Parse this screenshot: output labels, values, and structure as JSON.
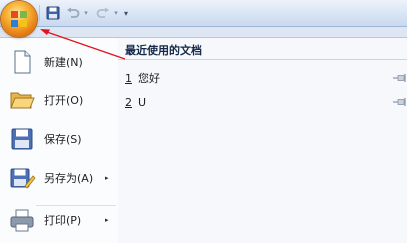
{
  "quick_access": {
    "office_button": "office-button",
    "save_icon": "save-icon",
    "undo_icon": "undo-icon",
    "redo_icon": "redo-icon",
    "dropdown_glyph": "▾",
    "customize_glyph": "▾"
  },
  "menu": {
    "items": [
      {
        "label": "新建(N)",
        "icon": "new-document-icon"
      },
      {
        "label": "打开(O)",
        "icon": "open-folder-icon"
      },
      {
        "label": "保存(S)",
        "icon": "save-icon"
      },
      {
        "label": "另存为(A)",
        "icon": "save-as-icon",
        "has_submenu": true
      },
      {
        "label": "打印(P)",
        "icon": "print-icon",
        "has_submenu": true
      }
    ],
    "submenu_glyph": "▸"
  },
  "recent": {
    "title": "最近使用的文档",
    "documents": [
      {
        "number": "1",
        "name": "您好"
      },
      {
        "number": "2",
        "name": "U"
      }
    ]
  },
  "colors": {
    "annotation_arrow": "#e0141e",
    "office_orange": "#f7b335"
  }
}
